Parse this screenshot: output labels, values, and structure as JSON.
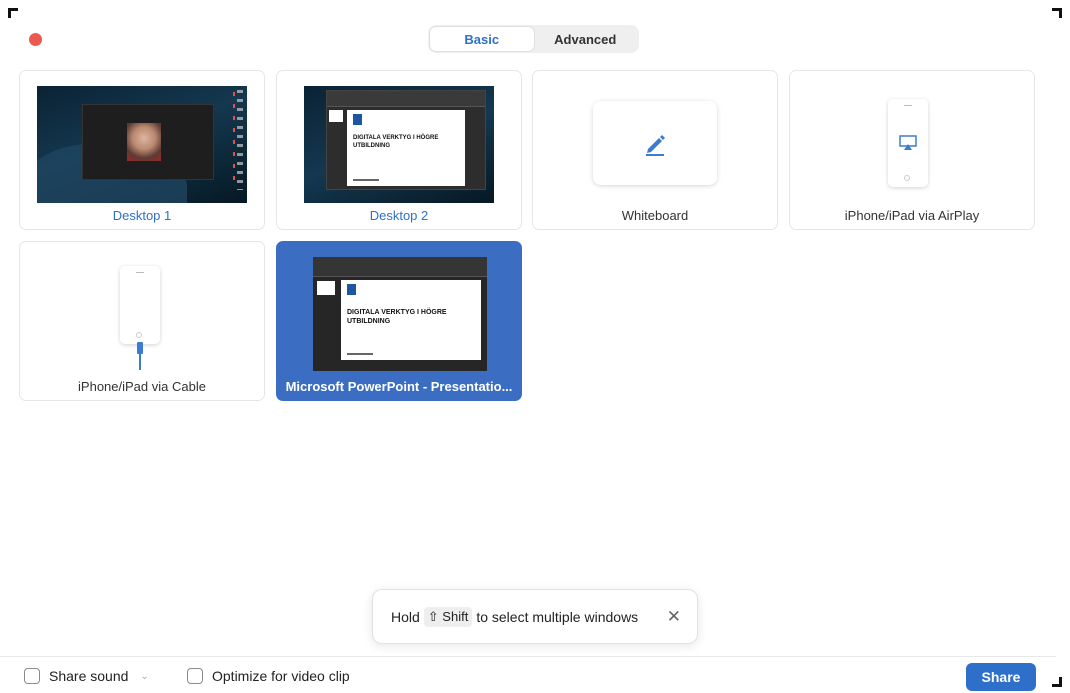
{
  "tabs": {
    "basic": "Basic",
    "advanced": "Advanced",
    "active": "Basic"
  },
  "tiles": [
    {
      "label": "Desktop 1"
    },
    {
      "label": "Desktop 2"
    },
    {
      "label": "Whiteboard"
    },
    {
      "label": "iPhone/iPad via AirPlay"
    },
    {
      "label": "iPhone/iPad via Cable"
    },
    {
      "label": "Microsoft PowerPoint - Presentatio..."
    }
  ],
  "thumbnails": {
    "desktop2_slide_title": "DIGITALA VERKTYG I HÖGRE UTBILDNING",
    "powerpoint_slide_title": "DIGITALA VERKTYG I HÖGRE UTBILDNING"
  },
  "toast": {
    "prefix": "Hold",
    "key": "⇧ Shift",
    "suffix": "to select multiple windows"
  },
  "footer": {
    "share_sound_label": "Share sound",
    "optimize_label": "Optimize for video clip",
    "share_button": "Share"
  },
  "colors": {
    "accent": "#2e70c9",
    "selected_tile": "#3b6ec2",
    "close_dot": "#ec5a4f"
  },
  "icons": [
    "pencil-icon",
    "airplay-icon",
    "close-icon",
    "chevron-down-icon",
    "shift-key-icon"
  ]
}
